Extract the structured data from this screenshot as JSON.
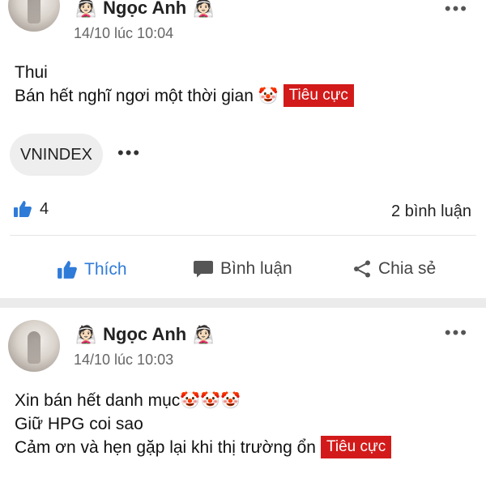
{
  "posts": [
    {
      "author": "Ngọc Anh",
      "timestamp": "14/10 lúc 10:04",
      "lines": [
        "Thui",
        "Bán hết nghĩ ngơi một thời gian"
      ],
      "clowns": "🤡",
      "sentiment": "Tiêu cực",
      "tag": "VNINDEX",
      "likes": "4",
      "comments": "2 bình luận",
      "actions": {
        "like": "Thích",
        "comment": "Bình luận",
        "share": "Chia sẻ"
      }
    },
    {
      "author": "Ngọc Anh",
      "timestamp": "14/10 lúc 10:03",
      "lines": [
        "Xin bán hết danh mục",
        "Giữ HPG coi sao",
        "Cảm ơn và hẹn gặp lại khi thị trường ổn"
      ],
      "clowns": "🤡🤡🤡",
      "sentiment": "Tiêu cực"
    }
  ],
  "icons": {
    "bride": "👰🏻",
    "more": "•••"
  },
  "colors": {
    "accent": "#2f7bd8",
    "negative": "#d31a1a"
  }
}
